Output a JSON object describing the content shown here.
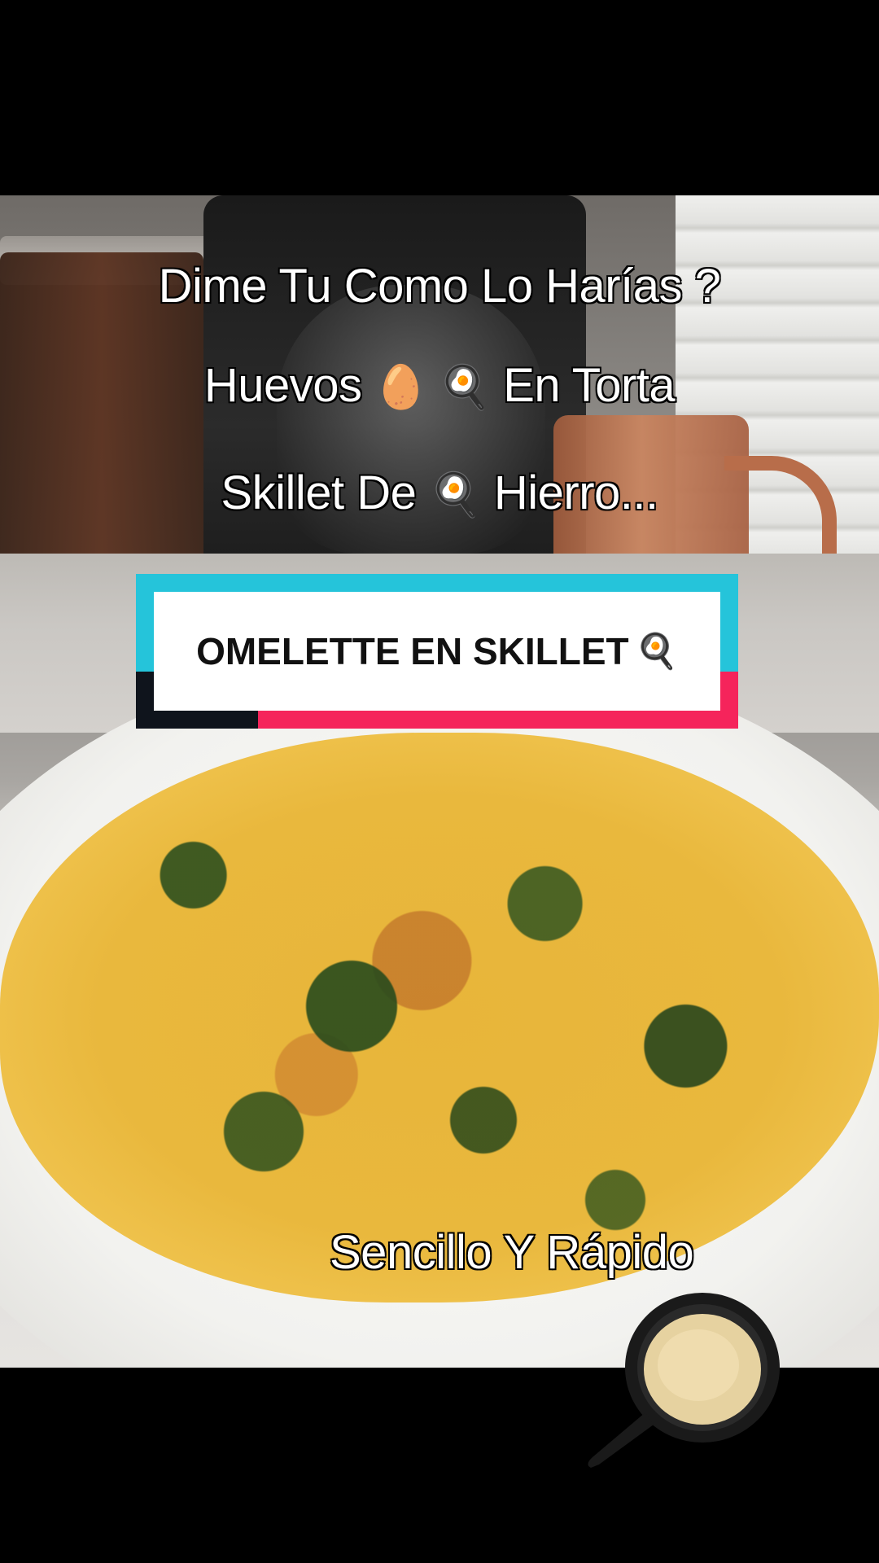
{
  "captions": {
    "line1": "Dime Tu Como Lo Harías ?",
    "line2_a": "Huevos ",
    "line2_b": "🥚 🍳",
    "line2_c": " En Torta",
    "line3_a": "Skillet  De ",
    "line3_b": "🍳",
    "line3_c": " Hierro...",
    "bottom": "Sencillo Y Rápido"
  },
  "title_card": {
    "text": "OMELETTE EN SKILLET",
    "emoji": "🍳",
    "colors": {
      "cyan": "#25c4da",
      "pink": "#f5245b",
      "dark": "#0f141c"
    }
  },
  "icons": {
    "sticker": "cast-iron-skillet-icon"
  }
}
